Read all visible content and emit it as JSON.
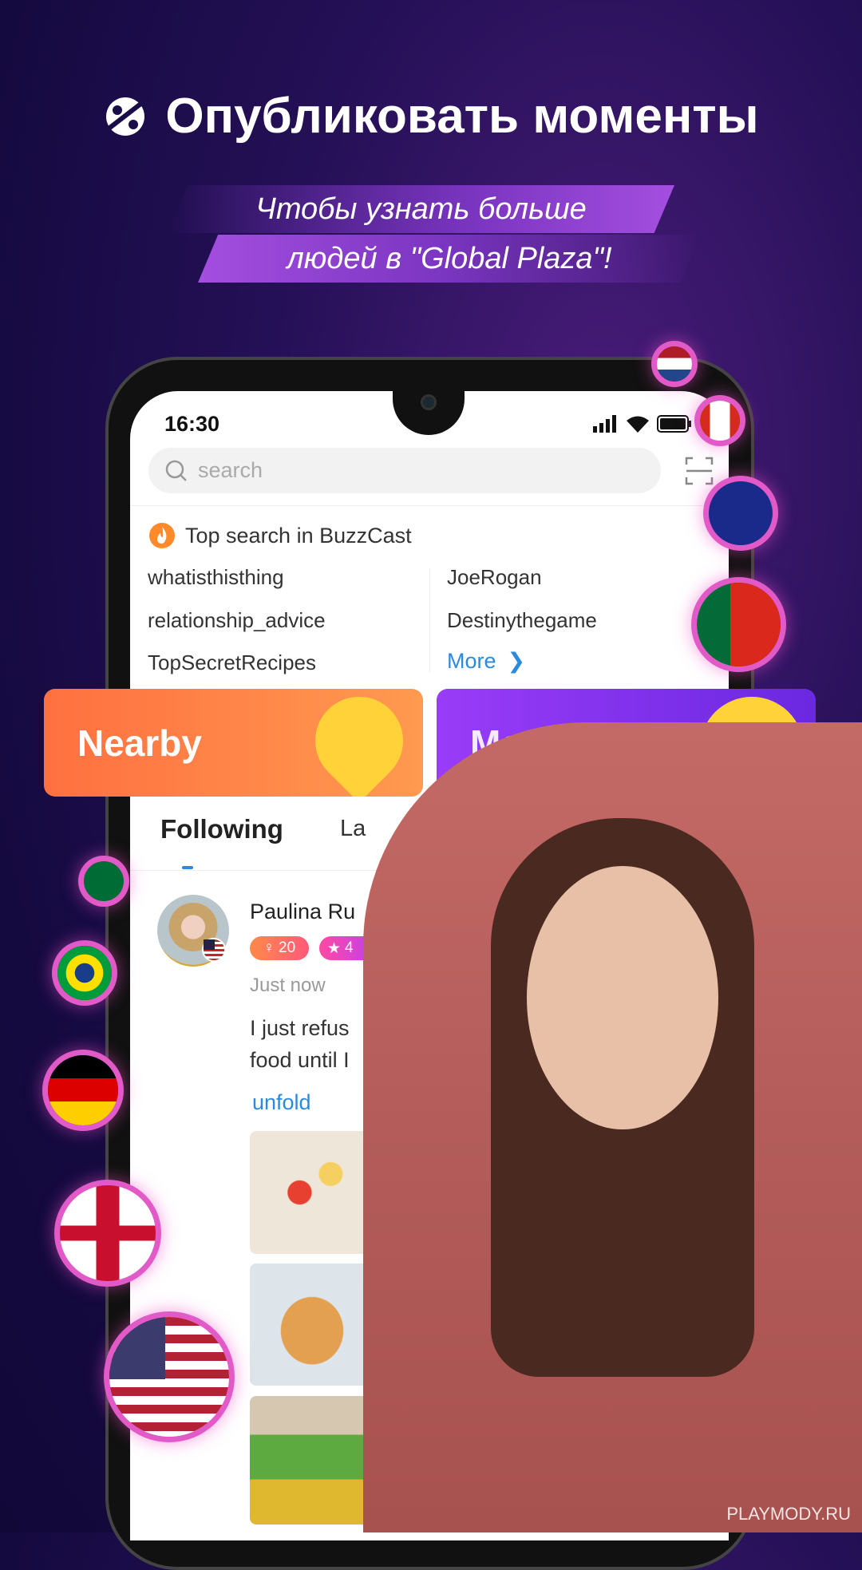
{
  "header": {
    "title": "Опубликовать моменты",
    "subtitle_line1": "Чтобы узнать больше",
    "subtitle_line2": "людей в \"Global Plaza\"!",
    "icon": "planet-icon"
  },
  "status_bar": {
    "time": "16:30"
  },
  "search": {
    "placeholder": "search"
  },
  "top_search": {
    "title_prefix": "Top search in",
    "brand": "BuzzCast",
    "left": [
      "whatisthisthing",
      "relationship_advice",
      "TopSecretRecipes"
    ],
    "right": [
      "JoeRogan",
      "Destinythegame"
    ],
    "more": "More"
  },
  "cards": {
    "nearby": "Nearby",
    "meet": "Meet"
  },
  "tabs": [
    "Following",
    "La"
  ],
  "post": {
    "name": "Paulina Ru",
    "badge1": "20",
    "badge2": "4",
    "time": "Just now",
    "text_line1": "I just refus",
    "text_line2": "food until I",
    "unfold": "unfold"
  },
  "watermark": "PLAYMODY.RU",
  "colors": {
    "accent": "#2a8ae0",
    "orange": "#ff7a3a",
    "purple": "#8a3cf0",
    "pink": "#e25ac8"
  }
}
